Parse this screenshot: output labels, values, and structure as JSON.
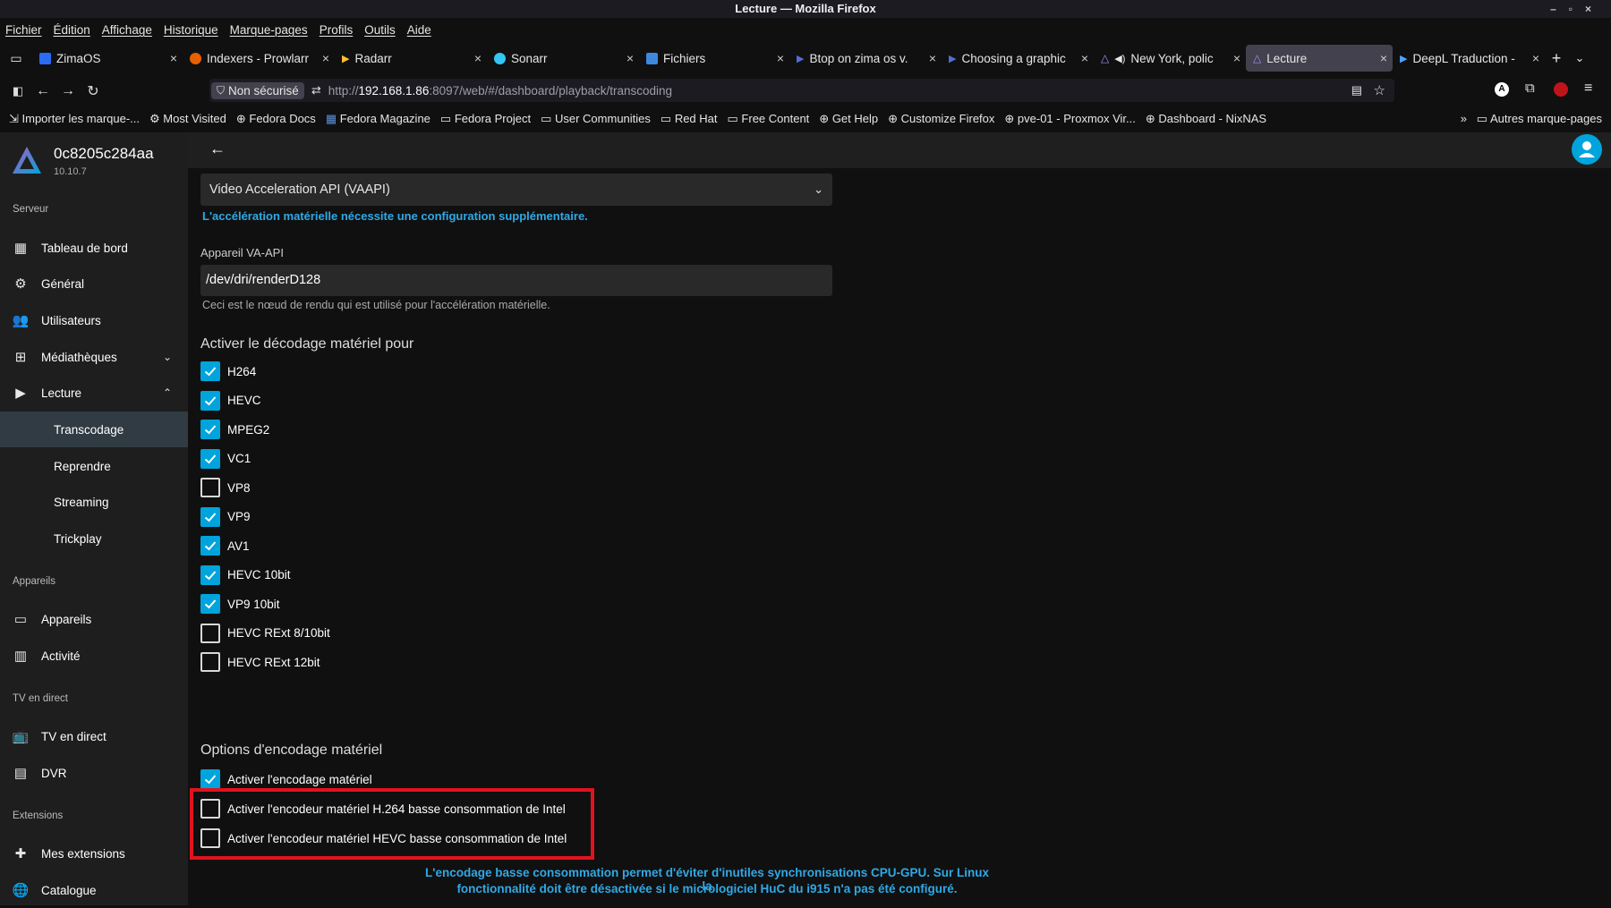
{
  "window": {
    "title": "Lecture — Mozilla Firefox"
  },
  "menu": [
    "Fichier",
    "Édition",
    "Affichage",
    "Historique",
    "Marque-pages",
    "Profils",
    "Outils",
    "Aide"
  ],
  "tabs": [
    {
      "label": "ZimaOS",
      "color": "#2a6df4"
    },
    {
      "label": "Indexers - Prowlarr",
      "color": "#e66000"
    },
    {
      "label": "Radarr",
      "color": "#ffc230"
    },
    {
      "label": "Sonarr",
      "color": "#35c5f4"
    },
    {
      "label": "Fichiers",
      "color": "#3f88e0"
    },
    {
      "label": "Btop on zima os v.",
      "color": "#1d4e9b"
    },
    {
      "label": "Choosing a graphic",
      "color": "#1d4e9b"
    },
    {
      "label": "New York, polic",
      "color": "#8a6df4"
    },
    {
      "label": "Lecture",
      "color": "#8a6df4"
    },
    {
      "label": "DeepL Traduction -",
      "color": "#0f2b46"
    }
  ],
  "navbar": {
    "security": "Non sécurisé",
    "url_prefix": "http://",
    "url_host": "192.168.1.86",
    "url_rest": ":8097/web/#/dashboard/playback/transcoding"
  },
  "bookmarks": [
    "Importer les marque-...",
    "Most Visited",
    "Fedora Docs",
    "Fedora Magazine",
    "Fedora Project",
    "User Communities",
    "Red Hat",
    "Free Content",
    "Get Help",
    "Customize Firefox",
    "pve-01 - Proxmox Vir...",
    "Dashboard - NixNAS"
  ],
  "bookmarks_right": "Autres marque-pages",
  "sidebar": {
    "server_name": "0c8205c284aa",
    "version": "10.10.7",
    "sections": {
      "serveur": "Serveur",
      "appareils": "Appareils",
      "tv": "TV en direct",
      "extensions": "Extensions"
    },
    "items": {
      "dashboard": "Tableau de bord",
      "general": "Général",
      "users": "Utilisateurs",
      "libraries": "Médiathèques",
      "playback": "Lecture",
      "devices": "Appareils",
      "activity": "Activité",
      "livetv": "TV en direct",
      "dvr": "DVR",
      "my_plugins": "Mes extensions",
      "catalog": "Catalogue"
    },
    "subitems": {
      "transcoding": "Transcodage",
      "resume": "Reprendre",
      "streaming": "Streaming",
      "trickplay": "Trickplay"
    }
  },
  "main": {
    "hw_accel_value": "Video Acceleration API (VAAPI)",
    "hw_accel_note": "L'accélération matérielle nécessite une configuration supplémentaire.",
    "vaapi_label": "Appareil VA-API",
    "vaapi_value": "/dev/dri/renderD128",
    "vaapi_help": "Ceci est le nœud de rendu qui est utilisé pour l'accélération matérielle.",
    "decoding_heading": "Activer le décodage matériel pour",
    "codecs": [
      {
        "label": "H264",
        "checked": true
      },
      {
        "label": "HEVC",
        "checked": true
      },
      {
        "label": "MPEG2",
        "checked": true
      },
      {
        "label": "VC1",
        "checked": true
      },
      {
        "label": "VP8",
        "checked": false
      },
      {
        "label": "VP9",
        "checked": true
      },
      {
        "label": "AV1",
        "checked": true
      },
      {
        "label": "HEVC 10bit",
        "checked": true
      },
      {
        "label": "VP9 10bit",
        "checked": true
      },
      {
        "label": "HEVC RExt 8/10bit",
        "checked": false
      },
      {
        "label": "HEVC RExt 12bit",
        "checked": false
      }
    ],
    "encoding_heading": "Options d'encodage matériel",
    "encoding_options": [
      {
        "label": "Activer l'encodage matériel",
        "checked": true
      },
      {
        "label": "Activer l'encodeur matériel H.264 basse consommation de Intel",
        "checked": false
      },
      {
        "label": "Activer l'encodeur matériel HEVC basse consommation de Intel",
        "checked": false
      }
    ],
    "lowpower_note_line1": "L'encodage basse consommation permet d'éviter d'inutiles synchronisations CPU-GPU. Sur Linux la",
    "lowpower_note_line2": "fonctionnalité doit être désactivée si le micrologiciel HuC du i915 n'a pas été configuré."
  }
}
